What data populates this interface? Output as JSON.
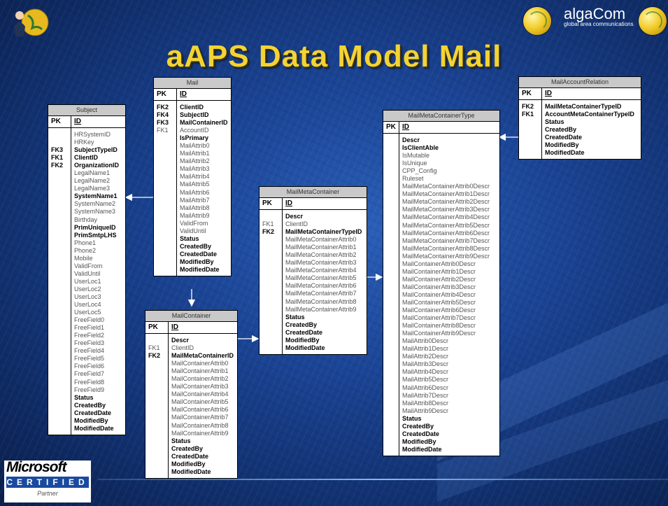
{
  "title": "aAPS Data Model Mail",
  "brand": {
    "name": "algaCom",
    "tagline": "global area communications"
  },
  "microsoft": {
    "word": "Microsoft",
    "certified": "CERTIFIED",
    "partner": "Partner"
  },
  "tables": {
    "subject": {
      "name": "Subject",
      "pk_label": "PK",
      "pk_field": "ID",
      "keys": [
        "",
        "",
        "FK3",
        "FK1",
        "FK2"
      ],
      "fields": [
        {
          "t": "HRSystemID",
          "b": false
        },
        {
          "t": "HRKey",
          "b": false
        },
        {
          "t": "SubjectTypeID",
          "b": true
        },
        {
          "t": "ClientID",
          "b": true
        },
        {
          "t": "OrganizationID",
          "b": true
        },
        {
          "t": "LegalName1",
          "b": false
        },
        {
          "t": "LegalName2",
          "b": false
        },
        {
          "t": "LegalName3",
          "b": false
        },
        {
          "t": "SystemName1",
          "b": true
        },
        {
          "t": "SystemName2",
          "b": false
        },
        {
          "t": "SystemName3",
          "b": false
        },
        {
          "t": "Birthday",
          "b": false
        },
        {
          "t": "PrimUniqueID",
          "b": true
        },
        {
          "t": "PrimSmtpLHS",
          "b": true
        },
        {
          "t": "Phone1",
          "b": false
        },
        {
          "t": "Phone2",
          "b": false
        },
        {
          "t": "Mobile",
          "b": false
        },
        {
          "t": "ValidFrom",
          "b": false
        },
        {
          "t": "ValidUntil",
          "b": false
        },
        {
          "t": "UserLoc1",
          "b": false
        },
        {
          "t": "UserLoc2",
          "b": false
        },
        {
          "t": "UserLoc3",
          "b": false
        },
        {
          "t": "UserLoc4",
          "b": false
        },
        {
          "t": "UserLoc5",
          "b": false
        },
        {
          "t": "FreeField0",
          "b": false
        },
        {
          "t": "FreeField1",
          "b": false
        },
        {
          "t": "FreeField2",
          "b": false
        },
        {
          "t": "FreeField3",
          "b": false
        },
        {
          "t": "FreeField4",
          "b": false
        },
        {
          "t": "FreeField5",
          "b": false
        },
        {
          "t": "FreeField6",
          "b": false
        },
        {
          "t": "FreeField7",
          "b": false
        },
        {
          "t": "FreeField8",
          "b": false
        },
        {
          "t": "FreeField9",
          "b": false
        },
        {
          "t": "Status",
          "b": true
        },
        {
          "t": "CreatedBy",
          "b": true
        },
        {
          "t": "CreatedDate",
          "b": true
        },
        {
          "t": "ModifiedBy",
          "b": true
        },
        {
          "t": "ModifiedDate",
          "b": true
        }
      ]
    },
    "mail": {
      "name": "Mail",
      "pk_label": "PK",
      "pk_field": "ID",
      "keys": [
        "FK2",
        "FK4",
        "FK3",
        "FK1"
      ],
      "fields": [
        {
          "t": "ClientID",
          "b": true
        },
        {
          "t": "SubjectID",
          "b": true
        },
        {
          "t": "MailContainerID",
          "b": true
        },
        {
          "t": "AccountID",
          "b": false
        },
        {
          "t": "IsPrimary",
          "b": true
        },
        {
          "t": "MailAttrib0",
          "b": false
        },
        {
          "t": "MailAttrib1",
          "b": false
        },
        {
          "t": "MailAttrib2",
          "b": false
        },
        {
          "t": "MailAttrib3",
          "b": false
        },
        {
          "t": "MailAttrib4",
          "b": false
        },
        {
          "t": "MailAttrib5",
          "b": false
        },
        {
          "t": "MailAttrib6",
          "b": false
        },
        {
          "t": "MailAttrib7",
          "b": false
        },
        {
          "t": "MailAttrib8",
          "b": false
        },
        {
          "t": "MailAttrib9",
          "b": false
        },
        {
          "t": "ValidFrom",
          "b": false
        },
        {
          "t": "ValidUntil",
          "b": false
        },
        {
          "t": "Status",
          "b": true
        },
        {
          "t": "CreatedBy",
          "b": true
        },
        {
          "t": "CreatedDate",
          "b": true
        },
        {
          "t": "ModifiedBy",
          "b": true
        },
        {
          "t": "ModifiedDate",
          "b": true
        }
      ]
    },
    "mailcontainer": {
      "name": "MailContainer",
      "pk_label": "PK",
      "pk_field": "ID",
      "keys": [
        "",
        "FK1",
        "FK2"
      ],
      "fields": [
        {
          "t": "Descr",
          "b": true
        },
        {
          "t": "ClientID",
          "b": false
        },
        {
          "t": "MailMetaContainerID",
          "b": true
        },
        {
          "t": "MailContainerAttrib0",
          "b": false
        },
        {
          "t": "MailContainerAttrib1",
          "b": false
        },
        {
          "t": "MailContainerAttrib2",
          "b": false
        },
        {
          "t": "MailContainerAttrib3",
          "b": false
        },
        {
          "t": "MailContainerAttrib4",
          "b": false
        },
        {
          "t": "MailContainerAttrib5",
          "b": false
        },
        {
          "t": "MailContainerAttrib6",
          "b": false
        },
        {
          "t": "MailContainerAttrib7",
          "b": false
        },
        {
          "t": "MailContainerAttrib8",
          "b": false
        },
        {
          "t": "MailContainerAttrib9",
          "b": false
        },
        {
          "t": "Status",
          "b": true
        },
        {
          "t": "CreatedBy",
          "b": true
        },
        {
          "t": "CreatedDate",
          "b": true
        },
        {
          "t": "ModifiedBy",
          "b": true
        },
        {
          "t": "ModifiedDate",
          "b": true
        }
      ]
    },
    "mailmetacontainer": {
      "name": "MailMetaContainer",
      "pk_label": "PK",
      "pk_field": "ID",
      "keys": [
        "",
        "FK1",
        "FK2"
      ],
      "fields": [
        {
          "t": "Descr",
          "b": true
        },
        {
          "t": "ClientID",
          "b": false
        },
        {
          "t": "MailMetaContainerTypeID",
          "b": true
        },
        {
          "t": "MailMetaContainerAttrib0",
          "b": false
        },
        {
          "t": "MailMetaContainerAttrib1",
          "b": false
        },
        {
          "t": "MailMetaContainerAttrib2",
          "b": false
        },
        {
          "t": "MailMetaContainerAttrib3",
          "b": false
        },
        {
          "t": "MailMetaContainerAttrib4",
          "b": false
        },
        {
          "t": "MailMetaContainerAttrib5",
          "b": false
        },
        {
          "t": "MailMetaContainerAttrib6",
          "b": false
        },
        {
          "t": "MailMetaContainerAttrib7",
          "b": false
        },
        {
          "t": "MailMetaContainerAttrib8",
          "b": false
        },
        {
          "t": "MailMetaContainerAttrib9",
          "b": false
        },
        {
          "t": "Status",
          "b": true
        },
        {
          "t": "CreatedBy",
          "b": true
        },
        {
          "t": "CreatedDate",
          "b": true
        },
        {
          "t": "ModifiedBy",
          "b": true
        },
        {
          "t": "ModifiedDate",
          "b": true
        }
      ]
    },
    "mailmetacontainertype": {
      "name": "MailMetaContainerType",
      "pk_label": "PK",
      "pk_field": "ID",
      "keys": [],
      "fields": [
        {
          "t": "Descr",
          "b": true
        },
        {
          "t": "IsClientAble",
          "b": true
        },
        {
          "t": "IsMutable",
          "b": false
        },
        {
          "t": "IsUnique",
          "b": false
        },
        {
          "t": "CPP_Config",
          "b": false
        },
        {
          "t": "Ruleset",
          "b": false
        },
        {
          "t": "MailMetaContainerAttrib0Descr",
          "b": false
        },
        {
          "t": "MailMetaContainerAttrib1Descr",
          "b": false
        },
        {
          "t": "MailMetaContainerAttrib2Descr",
          "b": false
        },
        {
          "t": "MailMetaContainerAttrib3Descr",
          "b": false
        },
        {
          "t": "MailMetaContainerAttrib4Descr",
          "b": false
        },
        {
          "t": "MailMetaContainerAttrib5Descr",
          "b": false
        },
        {
          "t": "MailMetaContainerAttrib6Descr",
          "b": false
        },
        {
          "t": "MailMetaContainerAttrib7Descr",
          "b": false
        },
        {
          "t": "MailMetaContainerAttrib8Descr",
          "b": false
        },
        {
          "t": "MailMetaContainerAttrib9Descr",
          "b": false
        },
        {
          "t": "MailContainerAttrib0Descr",
          "b": false
        },
        {
          "t": "MailContainerAttrib1Descr",
          "b": false
        },
        {
          "t": "MailContainerAttrib2Descr",
          "b": false
        },
        {
          "t": "MailContainerAttrib3Descr",
          "b": false
        },
        {
          "t": "MailContainerAttrib4Descr",
          "b": false
        },
        {
          "t": "MailContainerAttrib5Descr",
          "b": false
        },
        {
          "t": "MailContainerAttrib6Descr",
          "b": false
        },
        {
          "t": "MailContainerAttrib7Descr",
          "b": false
        },
        {
          "t": "MailContainerAttrib8Descr",
          "b": false
        },
        {
          "t": "MailContainerAttrib9Descr",
          "b": false
        },
        {
          "t": "MailAttrib0Descr",
          "b": false
        },
        {
          "t": "MailAttrib1Descr",
          "b": false
        },
        {
          "t": "MailAttrib2Descr",
          "b": false
        },
        {
          "t": "MailAttrib3Descr",
          "b": false
        },
        {
          "t": "MailAttrib4Descr",
          "b": false
        },
        {
          "t": "MailAttrib5Descr",
          "b": false
        },
        {
          "t": "MailAttrib6Descr",
          "b": false
        },
        {
          "t": "MailAttrib7Descr",
          "b": false
        },
        {
          "t": "MailAttrib8Descr",
          "b": false
        },
        {
          "t": "MailAttrib9Descr",
          "b": false
        },
        {
          "t": "Status",
          "b": true
        },
        {
          "t": "CreatedBy",
          "b": true
        },
        {
          "t": "CreatedDate",
          "b": true
        },
        {
          "t": "ModifiedBy",
          "b": true
        },
        {
          "t": "ModifiedDate",
          "b": true
        }
      ]
    },
    "mailaccountrelation": {
      "name": "MailAccountRelation",
      "pk_label": "PK",
      "pk_field": "ID",
      "keys": [
        "FK2",
        "FK1"
      ],
      "fields": [
        {
          "t": "MailMetaContainerTypeID",
          "b": true
        },
        {
          "t": "AccountMetaContainerTypeID",
          "b": true
        },
        {
          "t": "Status",
          "b": true
        },
        {
          "t": "CreatedBy",
          "b": true
        },
        {
          "t": "CreatedDate",
          "b": true
        },
        {
          "t": "ModifiedBy",
          "b": true
        },
        {
          "t": "ModifiedDate",
          "b": true
        }
      ]
    }
  }
}
